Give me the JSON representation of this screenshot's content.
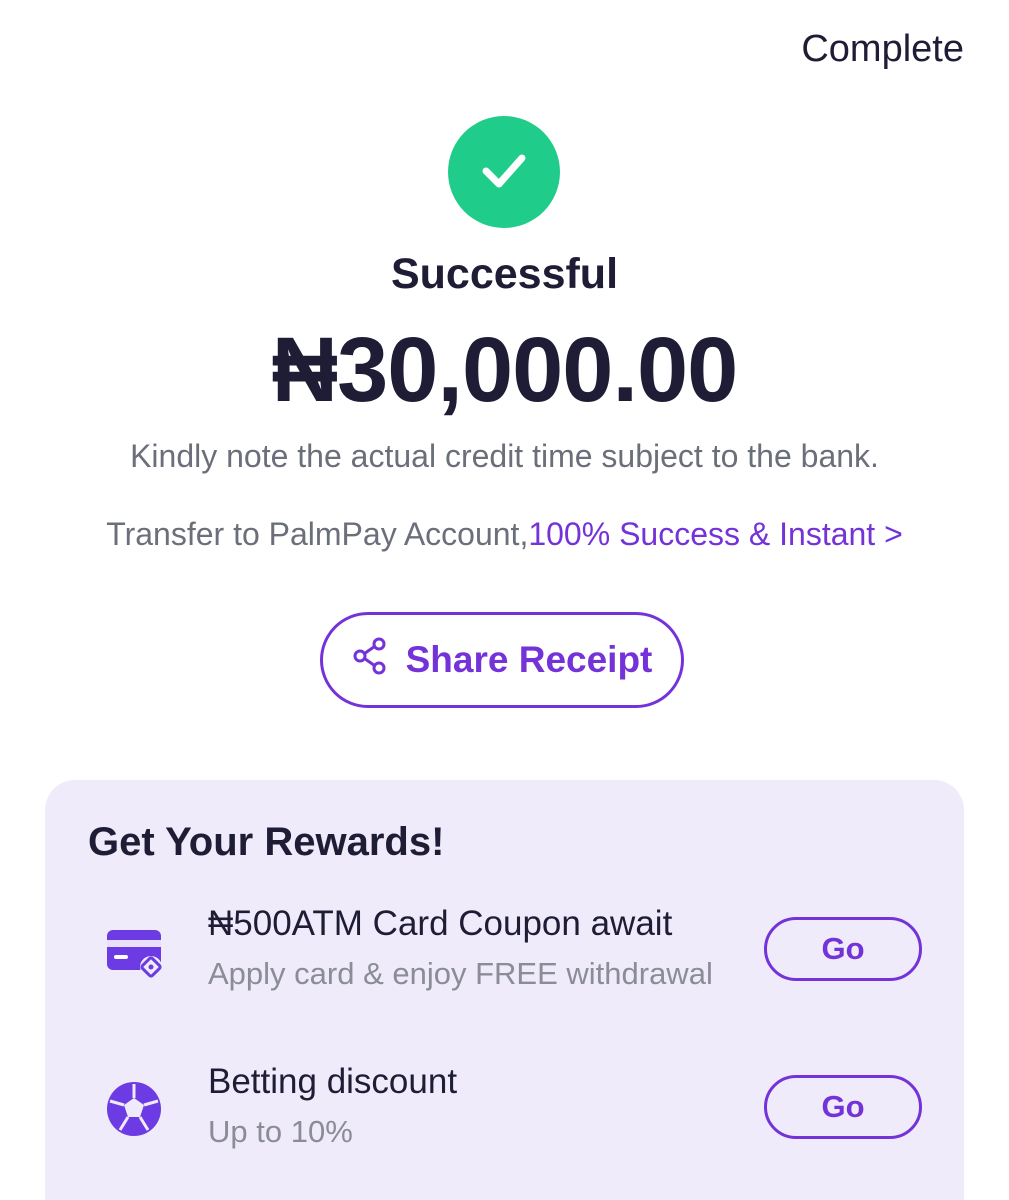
{
  "header": {
    "complete_label": "Complete"
  },
  "status": {
    "icon": "check-icon",
    "title": "Successful",
    "amount": "₦30,000.00",
    "note": "Kindly note the actual credit time subject to the bank.",
    "transfer_prefix": "Transfer to PalmPay Account,",
    "transfer_link": "100% Success & Instant >"
  },
  "share": {
    "icon": "share-icon",
    "label": "Share Receipt"
  },
  "rewards": {
    "title": "Get Your Rewards!",
    "items": [
      {
        "icon": "atm-card-icon",
        "title": "₦500ATM Card Coupon await",
        "subtitle": "Apply card & enjoy FREE withdrawal",
        "button": "Go"
      },
      {
        "icon": "football-icon",
        "title": "Betting discount",
        "subtitle": "Up to 10%",
        "button": "Go"
      }
    ]
  },
  "colors": {
    "accent": "#7433d8",
    "success": "#20cc8a",
    "text_dark": "#1f1d36",
    "text_muted": "#6b6f7a",
    "card_bg": "#efebfa"
  }
}
